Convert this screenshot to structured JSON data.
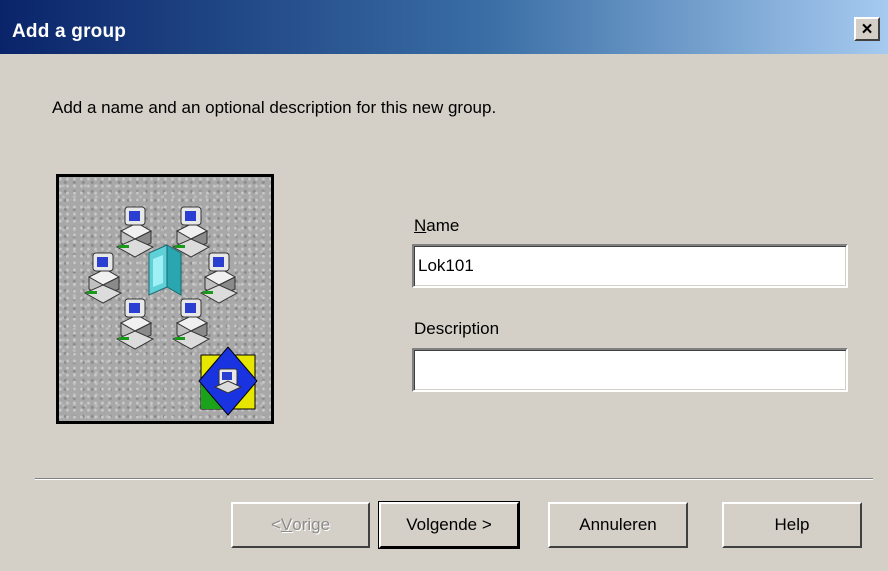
{
  "window": {
    "title": "Add a group",
    "close_glyph": "×"
  },
  "intro": "Add a name and an optional description for this new group.",
  "image": {
    "icon": "group-computers-illustration"
  },
  "name_field": {
    "label_underlined": "N",
    "label_rest": "ame",
    "value": "Lok101"
  },
  "description_field": {
    "label": "Description",
    "value": ""
  },
  "buttons": {
    "back_prefix": "< ",
    "back_underlined": "V",
    "back_rest": "orige",
    "next": "Volgende >",
    "cancel": "Annuleren",
    "help": "Help"
  }
}
